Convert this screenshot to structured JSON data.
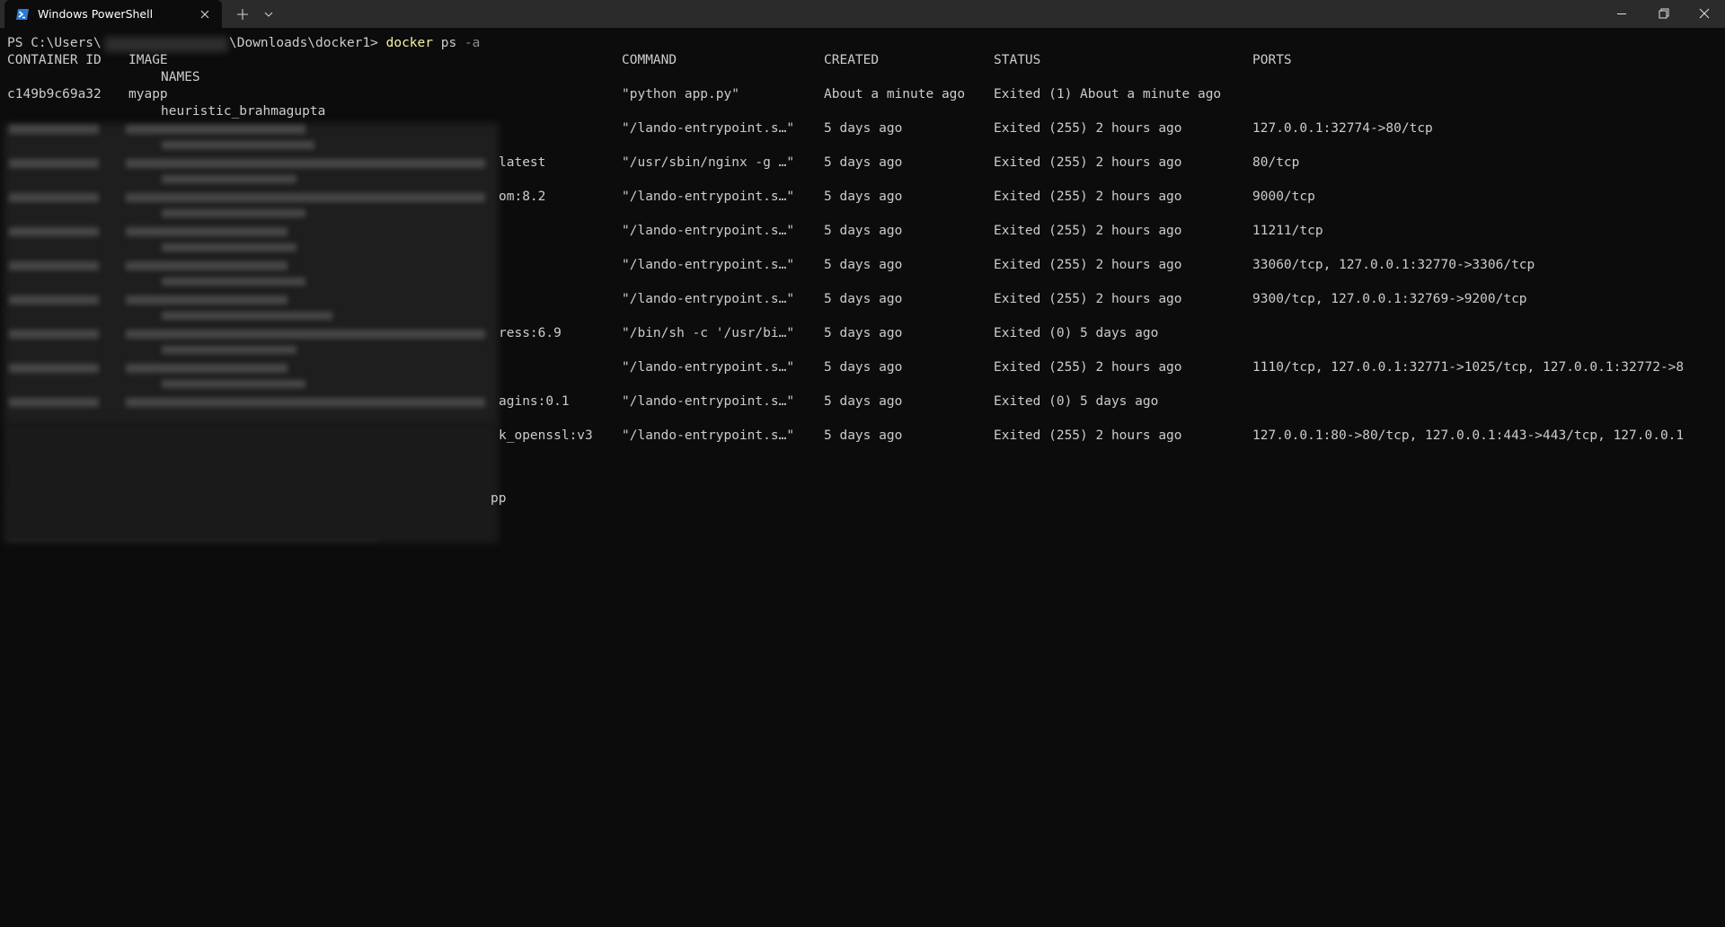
{
  "window": {
    "tab_title": "Windows PowerShell",
    "icons": {
      "tab": "powershell-icon",
      "tab_close": "close-icon",
      "new_tab": "plus-icon",
      "dropdown": "chevron-down-icon",
      "minimize": "minimize-icon",
      "maximize": "restore-icon",
      "close": "close-icon"
    }
  },
  "prompt": {
    "prefix": "PS C:\\Users\\",
    "suffix": "\\Downloads\\docker1> ",
    "command_name": "docker",
    "command_args": " ps ",
    "command_flag": "-a"
  },
  "headers": {
    "container_id": "CONTAINER ID",
    "image": "IMAGE",
    "command": "COMMAND",
    "created": "CREATED",
    "status": "STATUS",
    "ports": "PORTS",
    "names": "NAMES"
  },
  "first_row": {
    "container_id": "c149b9c69a32",
    "image": "myapp",
    "command": "\"python app.py\"",
    "created": "About a minute ago",
    "status": "Exited (1) About a minute ago",
    "ports": "",
    "name": "heuristic_brahmagupta"
  },
  "rows": [
    {
      "image_tail": "",
      "command": "\"/lando-entrypoint.s…\"",
      "created": "5 days ago",
      "status": "Exited (255) 2 hours ago",
      "ports": "127.0.0.1:32774->80/tcp"
    },
    {
      "image_tail": "latest",
      "command": "\"/usr/sbin/nginx -g …\"",
      "created": "5 days ago",
      "status": "Exited (255) 2 hours ago",
      "ports": "80/tcp"
    },
    {
      "image_tail": "om:8.2",
      "command": "\"/lando-entrypoint.s…\"",
      "created": "5 days ago",
      "status": "Exited (255) 2 hours ago",
      "ports": "9000/tcp"
    },
    {
      "image_tail": "",
      "command": "\"/lando-entrypoint.s…\"",
      "created": "5 days ago",
      "status": "Exited (255) 2 hours ago",
      "ports": "11211/tcp"
    },
    {
      "image_tail": "",
      "command": "\"/lando-entrypoint.s…\"",
      "created": "5 days ago",
      "status": "Exited (255) 2 hours ago",
      "ports": "33060/tcp, 127.0.0.1:32770->3306/tcp"
    },
    {
      "image_tail": "",
      "command": "\"/lando-entrypoint.s…\"",
      "created": "5 days ago",
      "status": "Exited (255) 2 hours ago",
      "ports": "9300/tcp, 127.0.0.1:32769->9200/tcp"
    },
    {
      "image_tail": "ress:6.9",
      "command": "\"/bin/sh -c '/usr/bi…\"",
      "created": "5 days ago",
      "status": "Exited (0) 5 days ago",
      "ports": ""
    },
    {
      "image_tail": "",
      "command": "\"/lando-entrypoint.s…\"",
      "created": "5 days ago",
      "status": "Exited (255) 2 hours ago",
      "ports": "1110/tcp, 127.0.0.1:32771->1025/tcp, 127.0.0.1:32772->8"
    },
    {
      "image_tail": "agins:0.1",
      "command": "\"/lando-entrypoint.s…\"",
      "created": "5 days ago",
      "status": "Exited (0) 5 days ago",
      "ports": ""
    },
    {
      "image_tail": "k_openssl:v3",
      "command": "\"/lando-entrypoint.s…\"",
      "created": "5 days ago",
      "status": "Exited (255) 2 hours ago",
      "ports": "127.0.0.1:80->80/tcp, 127.0.0.1:443->443/tcp, 127.0.0.1"
    }
  ],
  "trailing": {
    "text": "pp"
  }
}
